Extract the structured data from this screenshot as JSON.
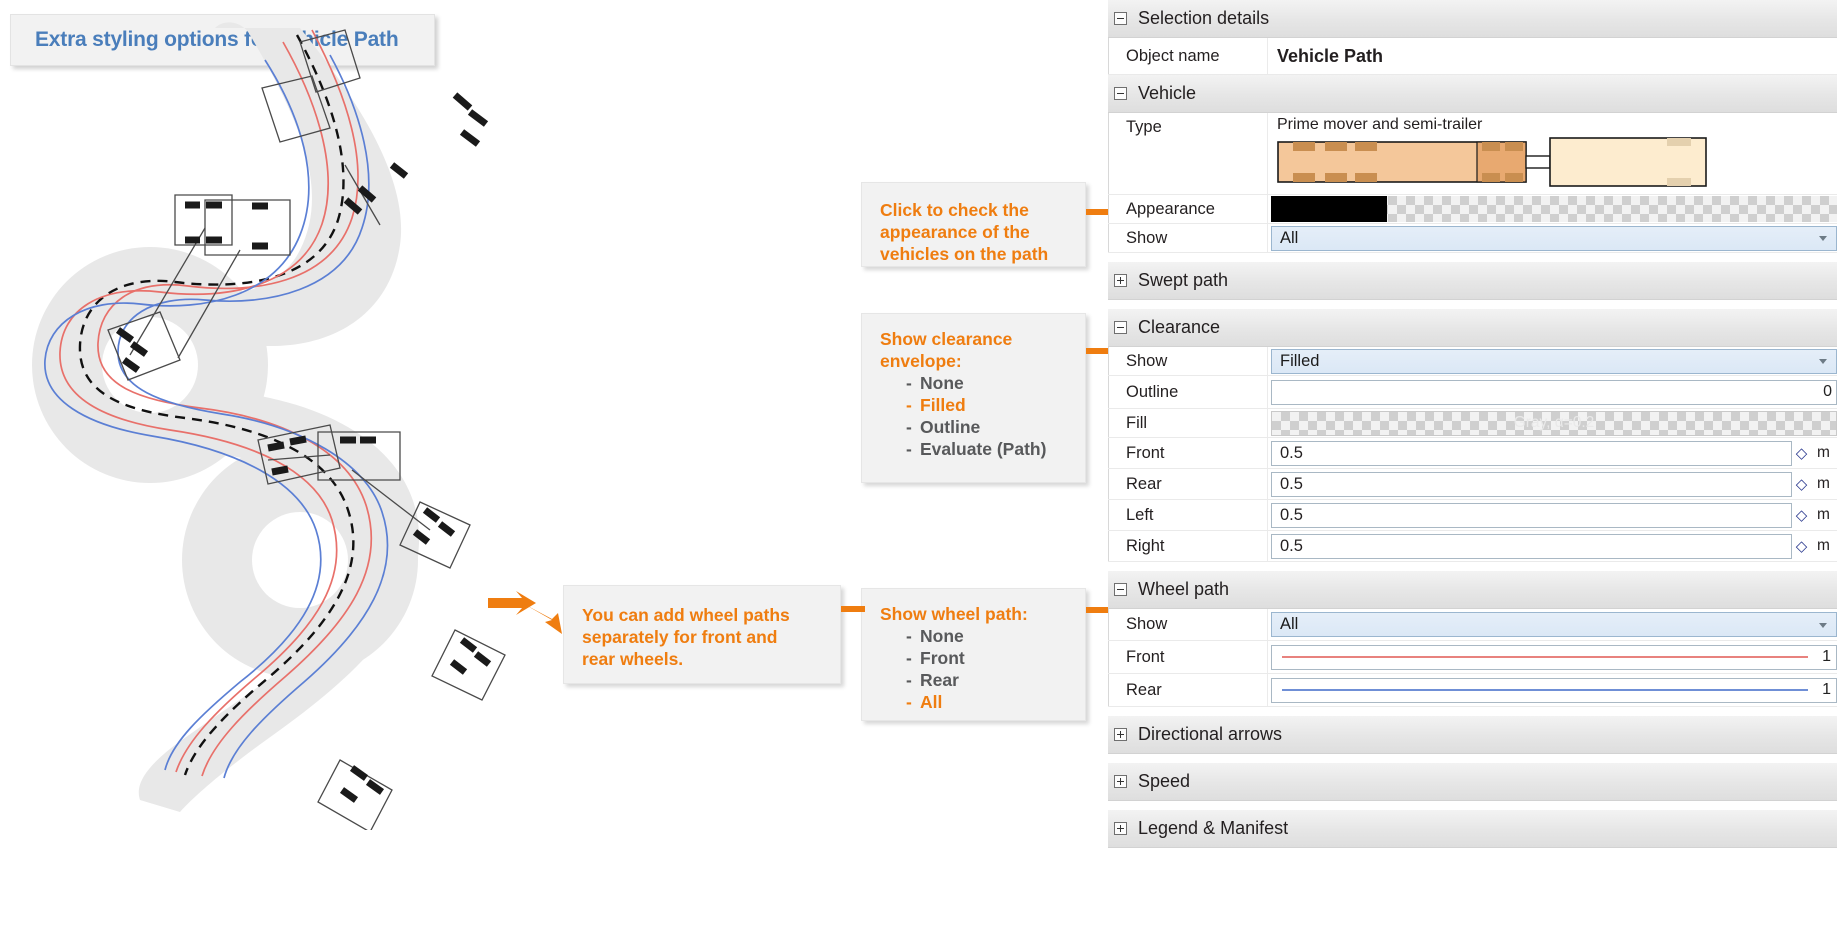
{
  "title_box": {
    "text": "Extra styling options for Vehicle Path",
    "color": "#4a7ebb"
  },
  "callouts": {
    "appearance": {
      "lines": [
        "Click to check the",
        "appearance of the",
        "vehicles on the path"
      ]
    },
    "clearance": {
      "heading": [
        "Show clearance",
        "envelope:"
      ],
      "options": [
        {
          "label": "None",
          "highlighted": false
        },
        {
          "label": "Filled",
          "highlighted": true
        },
        {
          "label": "Outline",
          "highlighted": false
        },
        {
          "label": "Evaluate (Path)",
          "highlighted": false
        }
      ]
    },
    "wheelpath_note": {
      "lines": [
        "You can add wheel paths",
        "separately for front and",
        "rear wheels."
      ]
    },
    "wheelpath": {
      "heading": [
        "Show wheel path:"
      ],
      "options": [
        {
          "label": "None",
          "highlighted": false
        },
        {
          "label": "Front",
          "highlighted": false
        },
        {
          "label": "Rear",
          "highlighted": false
        },
        {
          "label": "All",
          "highlighted": true
        }
      ]
    },
    "accent_color": "#ef7d10",
    "muted_color": "#58595b"
  },
  "panel": {
    "groups": [
      {
        "name": "Selection details",
        "expanded": true,
        "rows": [
          {
            "label": "Object name",
            "value": "Vehicle Path",
            "kind": "bold-text"
          }
        ]
      },
      {
        "name": "Vehicle",
        "expanded": true,
        "rows": [
          {
            "label": "Type",
            "value": "Prime mover and semi-trailer",
            "kind": "vehicle-preview"
          },
          {
            "label": "Appearance",
            "value": "",
            "kind": "appearance-swatch"
          },
          {
            "label": "Show",
            "value": "All",
            "kind": "combo"
          }
        ]
      },
      {
        "name": "Swept path",
        "expanded": false,
        "rows": []
      },
      {
        "name": "Clearance",
        "expanded": true,
        "rows": [
          {
            "label": "Show",
            "value": "Filled",
            "kind": "combo"
          },
          {
            "label": "Outline",
            "value": "",
            "right": "0",
            "kind": "text-right"
          },
          {
            "label": "Fill",
            "value": "Gray, α=0.2",
            "kind": "fill-swatch"
          },
          {
            "label": "Front",
            "value": "0.5",
            "unit": "m",
            "kind": "number"
          },
          {
            "label": "Rear",
            "value": "0.5",
            "unit": "m",
            "kind": "number"
          },
          {
            "label": "Left",
            "value": "0.5",
            "unit": "m",
            "kind": "number"
          },
          {
            "label": "Right",
            "value": "0.5",
            "unit": "m",
            "kind": "number"
          }
        ]
      },
      {
        "name": "Wheel path",
        "expanded": true,
        "rows": [
          {
            "label": "Show",
            "value": "All",
            "kind": "combo"
          },
          {
            "label": "Front",
            "value": "",
            "right": "1",
            "line_color": "#e8827e",
            "kind": "line"
          },
          {
            "label": "Rear",
            "value": "",
            "right": "1",
            "line_color": "#6f8fd6",
            "kind": "line"
          }
        ]
      },
      {
        "name": "Directional arrows",
        "expanded": false,
        "rows": []
      },
      {
        "name": "Speed",
        "expanded": false,
        "rows": []
      },
      {
        "name": "Legend & Manifest",
        "expanded": false,
        "rows": []
      }
    ]
  },
  "diagram": {
    "name": "vehicle-swept-path",
    "envelope_color": "#e8e8e8",
    "front_wheel_color": "#e8706a",
    "rear_wheel_color": "#5b7fd4",
    "centerline_color": "#111111",
    "body_outline_color": "#3a3a3a"
  }
}
